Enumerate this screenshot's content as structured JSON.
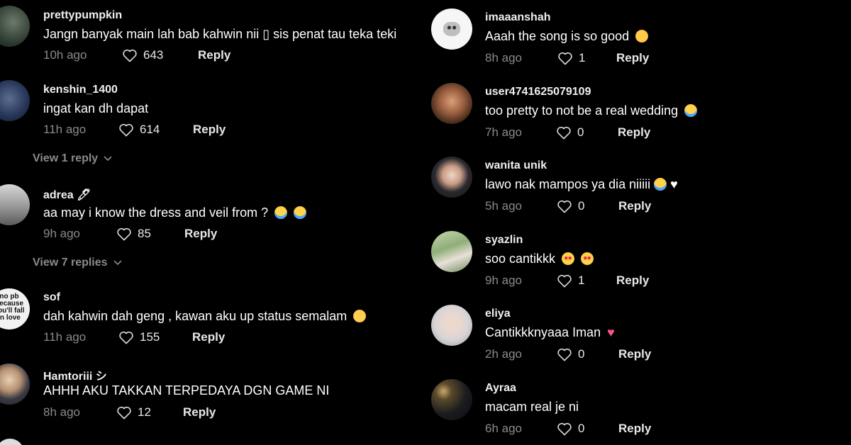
{
  "left_comments": [
    {
      "username": "prettypumpkin",
      "text": "Jangn banyak main lah bab kahwin nii ▯ sis penat tau teka teki",
      "time": "10h ago",
      "likes": "643",
      "reply": "Reply"
    },
    {
      "username": "kenshin_1400",
      "text": "ingat kan dh dapat",
      "time": "11h ago",
      "likes": "614",
      "reply": "Reply",
      "view_replies": "View 1 reply"
    },
    {
      "username": "adrea 🖊",
      "text": "aa may i know the dress and veil from ?",
      "time": "9h ago",
      "likes": "85",
      "reply": "Reply",
      "view_replies": "View 7 replies"
    },
    {
      "username": "sof",
      "text": "dah kahwin dah geng , kawan aku up status semalam",
      "time": "11h ago",
      "likes": "155",
      "reply": "Reply",
      "avatar_text": "no pb\nbecause\nyou'll fall\nin love"
    },
    {
      "username": "Hamtoriii シ",
      "text": "AHHH AKU TAKKAN TERPEDAYA DGN GAME NI",
      "time": "8h ago",
      "likes": "12",
      "reply": "Reply"
    }
  ],
  "right_comments": [
    {
      "username": "imaaanshah",
      "text": "Aaah the song is so good",
      "time": "8h ago",
      "likes": "1",
      "reply": "Reply"
    },
    {
      "username": "user4741625079109",
      "text": "too pretty to not be a real wedding",
      "time": "7h ago",
      "likes": "0",
      "reply": "Reply"
    },
    {
      "username": "wanita unik",
      "text": "lawo nak mampos ya dia niiiii",
      "time": "5h ago",
      "likes": "0",
      "reply": "Reply"
    },
    {
      "username": "syazlin",
      "text": "soo cantikkk",
      "time": "9h ago",
      "likes": "1",
      "reply": "Reply"
    },
    {
      "username": "eliya",
      "text": "Cantikkknyaaa Iman",
      "time": "2h ago",
      "likes": "0",
      "reply": "Reply"
    },
    {
      "username": "Ayraa",
      "text": "macam real je ni",
      "time": "6h ago",
      "likes": "0",
      "reply": "Reply"
    }
  ],
  "colors": {
    "background": "#000000",
    "muted": "#8a8a8a",
    "text": "#ffffff"
  },
  "icons": {
    "like": "heart-outline-icon",
    "expand": "chevron-down-icon"
  }
}
